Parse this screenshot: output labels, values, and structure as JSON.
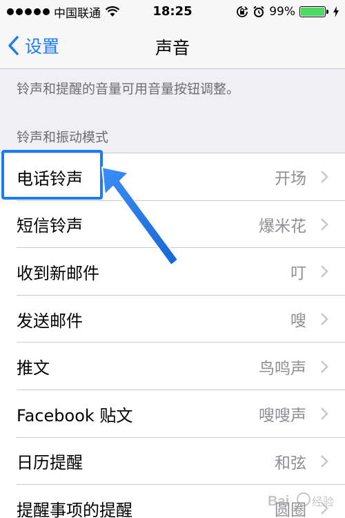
{
  "status_bar": {
    "carrier": "中国联通",
    "time": "18:25",
    "battery_percent": "99%",
    "battery_level": 0.99,
    "icons": [
      "signal-dots-icon",
      "wifi-icon",
      "rotation-lock-icon",
      "alarm-icon",
      "battery-icon",
      "charging-bolt-icon"
    ]
  },
  "nav": {
    "back_label": "设置",
    "title": "声音"
  },
  "hint": "铃声和提醒的音量可用音量按钮调整。",
  "section_header": "铃声和振动模式",
  "rows": [
    {
      "label": "电话铃声",
      "value": "开场"
    },
    {
      "label": "短信铃声",
      "value": "爆米花"
    },
    {
      "label": "收到新邮件",
      "value": "叮"
    },
    {
      "label": "发送邮件",
      "value": "嗖"
    },
    {
      "label": "推文",
      "value": "鸟鸣声"
    },
    {
      "label": "Facebook 贴文",
      "value": "嗖嗖声"
    },
    {
      "label": "日历提醒",
      "value": "和弦"
    },
    {
      "label": "提醒事项的提醒",
      "value": "圆圈"
    }
  ],
  "colors": {
    "accent": "#1a7bf5",
    "background": "#efeff4",
    "battery": "#4cd964"
  },
  "watermark": "Bai 经验"
}
